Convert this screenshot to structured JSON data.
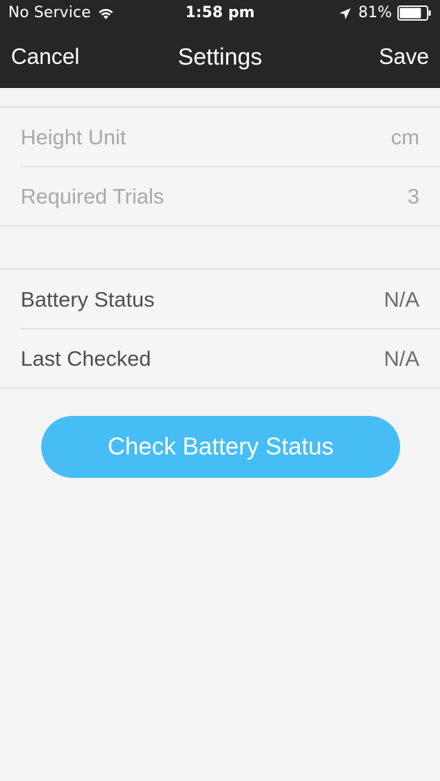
{
  "status_bar": {
    "carrier": "No Service",
    "time": "1:58 pm",
    "battery_percent": "81%",
    "battery_level": 0.81,
    "icons": [
      "wifi-icon",
      "location-arrow-icon",
      "battery-icon"
    ]
  },
  "nav": {
    "cancel_label": "Cancel",
    "title": "Settings",
    "save_label": "Save"
  },
  "settings_group": {
    "rows": [
      {
        "label": "Height Unit",
        "value": "cm"
      },
      {
        "label": "Required Trials",
        "value": "3"
      }
    ]
  },
  "battery_group": {
    "rows": [
      {
        "label": "Battery Status",
        "value": "N/A"
      },
      {
        "label": "Last Checked",
        "value": "N/A"
      }
    ]
  },
  "actions": {
    "check_battery_label": "Check Battery Status"
  },
  "colors": {
    "nav_background": "#262626",
    "page_background": "#f4f4f5",
    "button_accent": "#47bdf5"
  }
}
